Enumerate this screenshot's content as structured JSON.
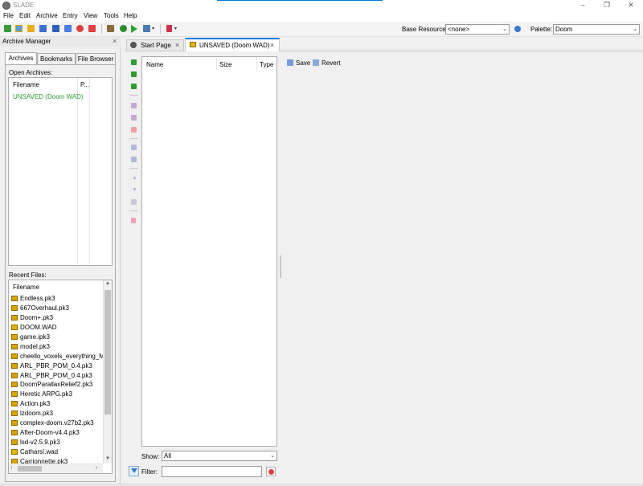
{
  "window": {
    "title": "SLADE"
  },
  "menubar": {
    "items": [
      "File",
      "Edit",
      "Archive",
      "Entry",
      "View",
      "Tools",
      "Help"
    ]
  },
  "toolbar": {
    "base_resource_label": "Base Resource:",
    "base_resource_value": "<none>",
    "palette_label": "Palette:",
    "palette_value": "Doom"
  },
  "archive_manager": {
    "title": "Archive Manager",
    "close_glyph": "×",
    "tabs": [
      "Archives",
      "Bookmarks",
      "File Browser"
    ],
    "open_archives_label": "Open Archives:",
    "open_archives_columns": [
      "Filename",
      "P..."
    ],
    "open_archives": [
      "UNSAVED (Doom WAD)"
    ],
    "recent_files_label": "Recent Files:",
    "recent_files_column": "Filename",
    "recent_files": [
      {
        "name": "Endless.pk3",
        "kind": "zip"
      },
      {
        "name": "667Overhaul.pk3",
        "kind": "zip"
      },
      {
        "name": "Doom+.pk3",
        "kind": "zip"
      },
      {
        "name": "DOOM.WAD",
        "kind": "wad"
      },
      {
        "name": "game.ipk3",
        "kind": "zip"
      },
      {
        "name": "model.pk3",
        "kind": "zip"
      },
      {
        "name": "cheello_voxels_everything_MAY",
        "kind": "zip"
      },
      {
        "name": "ARL_PBR_POM_0.4.pk3",
        "kind": "zip"
      },
      {
        "name": "ARL_PBR_POM_0.4.pk3",
        "kind": "zip"
      },
      {
        "name": "DoomParallaxRelief2.pk3",
        "kind": "zip"
      },
      {
        "name": "Heretic ARPG.pk3",
        "kind": "zip"
      },
      {
        "name": "Action.pk3",
        "kind": "zip"
      },
      {
        "name": "lzdoom.pk3",
        "kind": "zip"
      },
      {
        "name": "complex-doom.v27b2.pk3",
        "kind": "zip"
      },
      {
        "name": "After-Doom-v4.4.pk3",
        "kind": "zip"
      },
      {
        "name": "lsd-v2.5.9.pk3",
        "kind": "zip"
      },
      {
        "name": "Catharsī.wad",
        "kind": "wad"
      },
      {
        "name": "Carrionnette.pk3",
        "kind": "zip"
      }
    ]
  },
  "doc_tabs": [
    {
      "label": "Start Page",
      "close": "×"
    },
    {
      "label": "UNSAVED (Doom WAD)",
      "close": "×"
    }
  ],
  "entry_list": {
    "columns": [
      "Name",
      "Size",
      "Type"
    ],
    "show_label": "Show:",
    "show_value": "All",
    "filter_label": "Filter:",
    "filter_value": ""
  },
  "entry_panel": {
    "save_label": "Save",
    "revert_label": "Revert"
  },
  "colors": {
    "open_archive_text": "#2d9d2d",
    "accent_blue": "#0078d7",
    "clear_filter_red": "#e04040"
  }
}
